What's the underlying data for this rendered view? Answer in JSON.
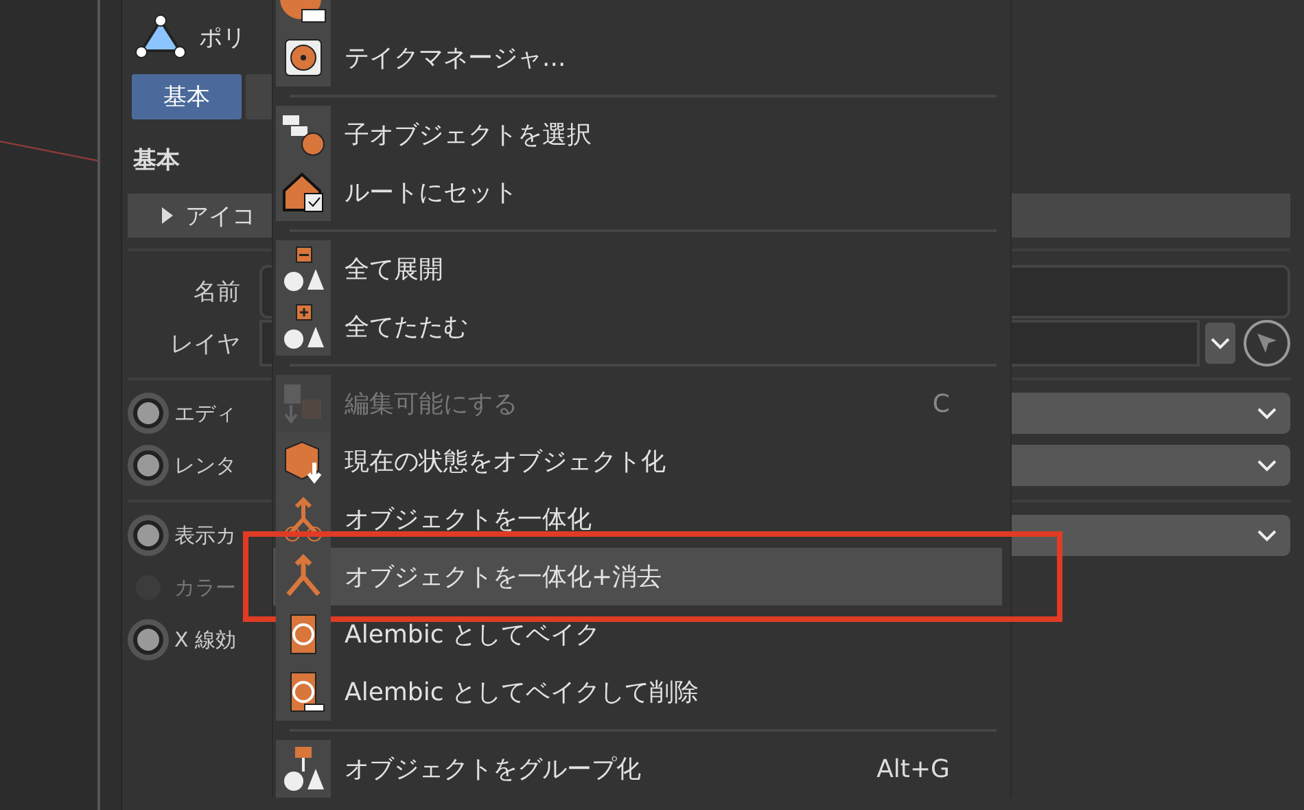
{
  "panel": {
    "object_name": "ポリ",
    "tabs": [
      {
        "label": "基本",
        "selected": true
      },
      {
        "selected": false
      }
    ],
    "section_title": "基本",
    "accordion": {
      "label": "アイコ",
      "expanded": false
    },
    "fields": [
      {
        "label": "名前",
        "kind": "text"
      },
      {
        "label": "レイヤ",
        "kind": "layer"
      }
    ],
    "option_groups": [
      [
        {
          "label": "エディ",
          "disabled": false
        },
        {
          "label": "レンタ",
          "disabled": false
        }
      ],
      [
        {
          "label": "表示カ",
          "disabled": false,
          "dropdown": true
        },
        {
          "label": "カラー",
          "disabled": true,
          "dropdown": false
        },
        {
          "label": "X 線効",
          "disabled": false,
          "dropdown": false
        }
      ]
    ]
  },
  "context_menu": {
    "sections": [
      {
        "items": [
          {
            "disabled": false,
            "selected": false
          },
          {
            "label": "テイクマネージャ...",
            "disabled": false,
            "selected": false
          }
        ]
      },
      {
        "items": [
          {
            "label": "子オブジェクトを選択",
            "disabled": false,
            "selected": false
          },
          {
            "label": "ルートにセット",
            "disabled": false,
            "selected": false
          }
        ]
      },
      {
        "items": [
          {
            "label": "全て展開",
            "disabled": false,
            "selected": false
          },
          {
            "label": "全てたたむ",
            "disabled": false,
            "selected": false
          }
        ]
      },
      {
        "items": [
          {
            "label": "編集可能にする",
            "shortcut": "C",
            "disabled": true,
            "selected": false
          },
          {
            "label": "現在の状態をオブジェクト化",
            "disabled": false,
            "selected": false
          },
          {
            "label": "オブジェクトを一体化",
            "disabled": false,
            "selected": false
          },
          {
            "label": "オブジェクトを一体化+消去",
            "disabled": false,
            "selected": true,
            "annotated": true
          },
          {
            "label": "Alembic としてベイク",
            "disabled": false,
            "selected": false
          },
          {
            "label": "Alembic としてベイクして削除",
            "disabled": false,
            "selected": false
          }
        ]
      },
      {
        "items": [
          {
            "label": "オブジェクトをグループ化",
            "shortcut": "Alt+G",
            "disabled": false,
            "selected": false
          }
        ]
      }
    ]
  }
}
